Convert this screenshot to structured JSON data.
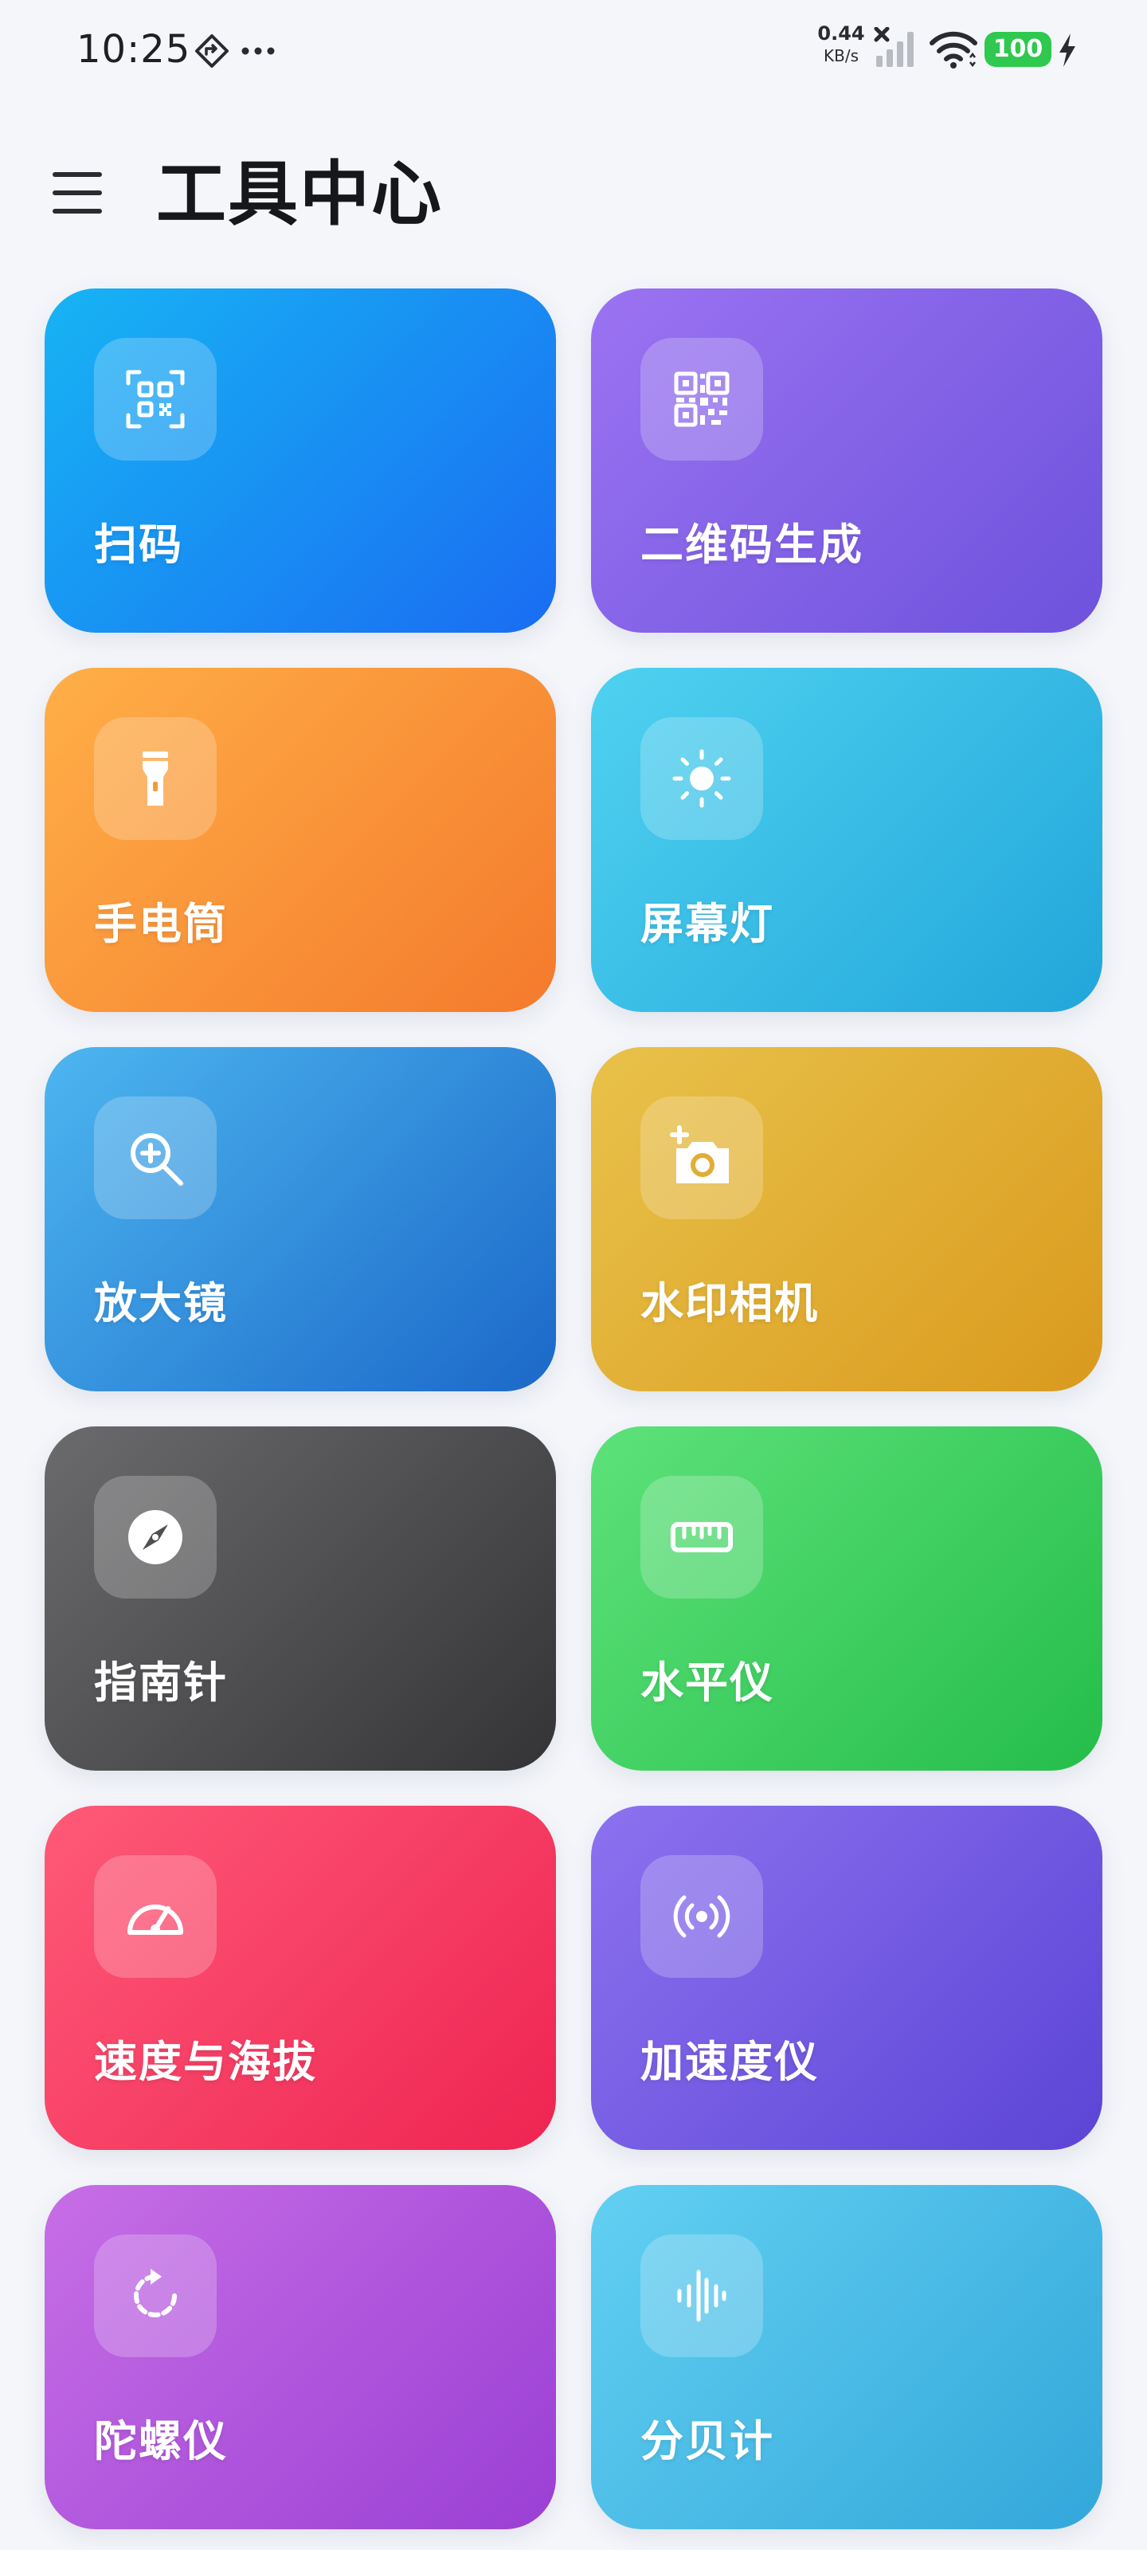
{
  "status_bar": {
    "time": "10:25",
    "net_speed_value": "0.44",
    "net_speed_unit": "KB/s",
    "battery": "100"
  },
  "header": {
    "title": "工具中心"
  },
  "tools": [
    {
      "label": "扫码",
      "icon": "scan-qr-icon",
      "gradient": [
        "#17b4f4",
        "#1a6cf2"
      ]
    },
    {
      "label": "二维码生成",
      "icon": "qr-code-icon",
      "gradient": [
        "#9b73f2",
        "#6d52dc"
      ]
    },
    {
      "label": "手电筒",
      "icon": "flashlight-icon",
      "gradient": [
        "#ffaf48",
        "#f47a2c"
      ]
    },
    {
      "label": "屏幕灯",
      "icon": "sun-icon",
      "gradient": [
        "#4fd2f0",
        "#22a6da"
      ]
    },
    {
      "label": "放大镜",
      "icon": "magnifier-plus-icon",
      "gradient": [
        "#4db6f0",
        "#1b68c8"
      ]
    },
    {
      "label": "水印相机",
      "icon": "camera-add-icon",
      "gradient": [
        "#e9c24a",
        "#d99a1e"
      ]
    },
    {
      "label": "指南针",
      "icon": "compass-icon",
      "gradient": [
        "#6b6b6d",
        "#343436"
      ]
    },
    {
      "label": "水平仪",
      "icon": "ruler-icon",
      "gradient": [
        "#5de27a",
        "#25bd4a"
      ]
    },
    {
      "label": "速度与海拔",
      "icon": "speedometer-icon",
      "gradient": [
        "#ff5a78",
        "#ee2451"
      ]
    },
    {
      "label": "加速度仪",
      "icon": "broadcast-icon",
      "gradient": [
        "#8c72ef",
        "#5c44d6"
      ]
    },
    {
      "label": "陀螺仪",
      "icon": "rotate-icon",
      "gradient": [
        "#c76ee6",
        "#9a3fd4"
      ]
    },
    {
      "label": "分贝计",
      "icon": "sound-wave-icon",
      "gradient": [
        "#62d0f2",
        "#33a7da"
      ]
    }
  ]
}
